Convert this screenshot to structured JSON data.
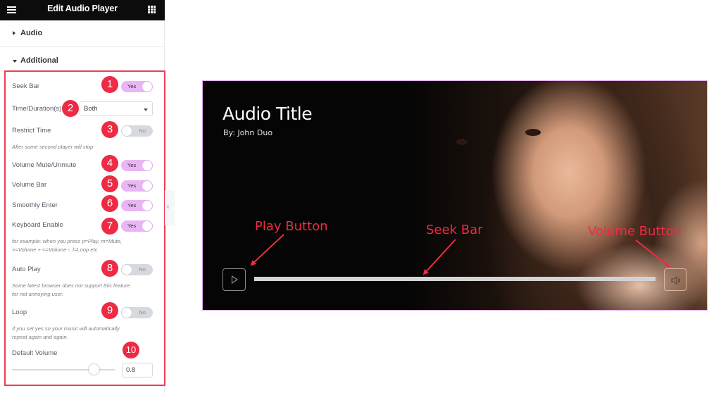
{
  "panel": {
    "title": "Edit Audio Player",
    "menu_icon": "hamburger-icon",
    "apps_icon": "grid-icon",
    "sections": [
      {
        "label": "Audio",
        "state": "collapsed"
      },
      {
        "label": "Additional",
        "state": "expanded"
      }
    ],
    "controls": {
      "seek_bar": {
        "label": "Seek Bar",
        "value": "Yes",
        "badge": "1"
      },
      "time_duration": {
        "label": "Time/Duration(s)",
        "value": "Both",
        "badge": "2"
      },
      "restrict_time": {
        "label": "Restrict Time",
        "value": "No",
        "badge": "3",
        "description": "After some second player will stop"
      },
      "volume_mute": {
        "label": "Volume Mute/Unmute",
        "value": "Yes",
        "badge": "4"
      },
      "volume_bar": {
        "label": "Volume Bar",
        "value": "Yes",
        "badge": "5"
      },
      "smoothly_enter": {
        "label": "Smoothly Enter",
        "value": "Yes",
        "badge": "6"
      },
      "keyboard_enable": {
        "label": "Keyboard Enable",
        "value": "Yes",
        "badge": "7",
        "description_line1": "for example: when you press p=Play, m=Mute,",
        "description_line2": ">=Volume + <=Volume -, l=Loop etc"
      },
      "auto_play": {
        "label": "Auto Play",
        "value": "No",
        "badge": "8",
        "description_line1": "Some latest browser does not support this feature",
        "description_line2": "for not annoying user."
      },
      "loop": {
        "label": "Loop",
        "value": "No",
        "badge": "9",
        "description_line1": "If you set yes so your music will automatically",
        "description_line2": "repeat again and again."
      },
      "default_volume": {
        "label": "Default Volume",
        "value": "0.8",
        "slider_fraction": 0.8,
        "badge": "10"
      }
    }
  },
  "player": {
    "title": "Audio Title",
    "artist": "By: John Duo",
    "play_icon": "play-icon",
    "volume_icon": "speaker-icon",
    "seek_progress": 0
  },
  "annotations": {
    "play_button": "Play Button",
    "seek_bar": "Seek Bar",
    "volume_button": "Volume Button"
  },
  "colors": {
    "accent_toggle_on": "#e9b5f5",
    "badge": "#ee2a44",
    "highlight_border": "#ef3d55",
    "annotation": "#f02a44"
  }
}
